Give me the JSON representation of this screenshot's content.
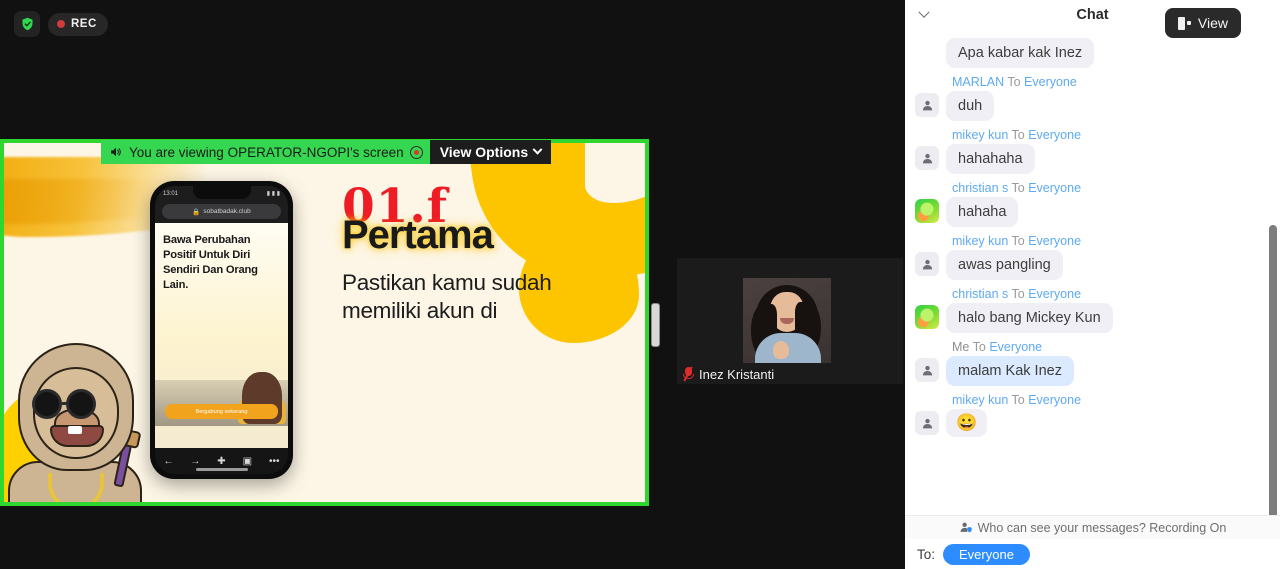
{
  "topbar": {
    "shield_icon": "shield-check-icon",
    "recording_label": "REC",
    "view_button_label": "View",
    "view_button_icon": "layout-icon"
  },
  "share": {
    "banner_text": "You are viewing OPERATOR-NGOPI's screen",
    "speaker_icon": "speaker-icon",
    "recording_dot_icon": "recording-indicator-icon",
    "view_options_label": "View Options",
    "view_options_chevron": "chevron-down-icon",
    "slide": {
      "number": "01.f",
      "heading": "Pertama",
      "subtitle_line1": "Pastikan kamu sudah",
      "subtitle_line2": "memiliki akun di",
      "phone": {
        "url": "sobatbadak.club",
        "status_time": "13:01",
        "headline": "Bawa Perubahan Positif Untuk Diri Sendiri Dan Orang Lain.",
        "cta_label": "Bergabung sekarang"
      }
    }
  },
  "tile": {
    "participant_name": "Inez Kristanti",
    "mic_icon": "microphone-muted-icon"
  },
  "chat": {
    "title": "Chat",
    "collapse_icon": "chevron-down-icon",
    "messages": [
      {
        "from": "",
        "to": "",
        "text": "Apa kabar kak Inez",
        "avatar": "none",
        "self": false,
        "continued": true
      },
      {
        "from": "MARLAN",
        "to_label": "To",
        "to": "Everyone",
        "text": "duh",
        "avatar": "person-icon",
        "self": false
      },
      {
        "from": "mikey kun",
        "to_label": "To",
        "to": "Everyone",
        "text": "hahahaha",
        "avatar": "person-icon",
        "self": false
      },
      {
        "from": "christian s",
        "to_label": "To",
        "to": "Everyone",
        "text": "hahaha",
        "avatar": "photo-avatar",
        "self": false
      },
      {
        "from": "mikey kun",
        "to_label": "To",
        "to": "Everyone",
        "text": "awas pangling",
        "avatar": "person-icon",
        "self": false
      },
      {
        "from": "christian s",
        "to_label": "To",
        "to": "Everyone",
        "text": "halo bang Mickey Kun",
        "avatar": "photo-avatar",
        "self": false
      },
      {
        "from": "Me",
        "to_label": "To",
        "to": "Everyone",
        "text": "malam Kak Inez",
        "avatar": "person-icon",
        "self": true
      },
      {
        "from": "mikey kun",
        "to_label": "To",
        "to": "Everyone",
        "text": "😀",
        "avatar": "person-icon",
        "self": false,
        "emoji": true
      }
    ],
    "notice_icon": "person-shield-icon",
    "notice_text": "Who can see your messages? Recording On",
    "to_label": "To:",
    "to_value": "Everyone"
  },
  "colors": {
    "accent_blue": "#2d8cff",
    "share_green": "#36d750",
    "border_green": "#2fd62f",
    "rec_red": "#d23b3b",
    "slide_red": "#ee1c24",
    "slide_yellow": "#fdc500"
  }
}
